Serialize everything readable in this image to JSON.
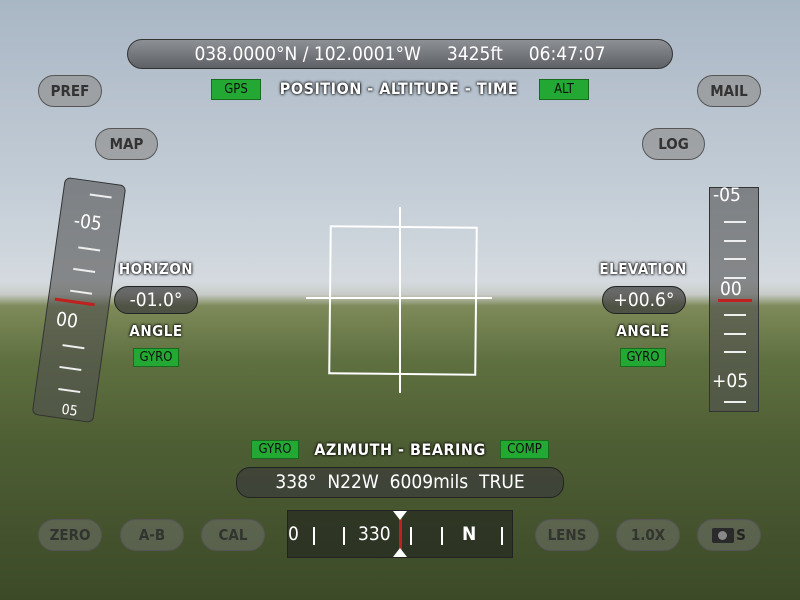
{
  "top": {
    "position": "038.0000°N / 102.0001°W",
    "altitude": "3425ft",
    "time": "06:47:07",
    "title": "POSITION - ALTITUDE - TIME",
    "gps_badge": "GPS",
    "alt_badge": "ALT"
  },
  "buttons": {
    "pref": "PREF",
    "mail": "MAIL",
    "map": "MAP",
    "log": "LOG",
    "zero": "ZERO",
    "ab": "A-B",
    "cal": "CAL",
    "lens": "LENS",
    "zoom": "1.0X",
    "shutter_suffix": "S"
  },
  "horizon": {
    "title": "HORIZON",
    "value": "-01.0°",
    "subtitle": "ANGLE",
    "badge": "GYRO",
    "tape_labels": [
      "-05",
      "00",
      "05"
    ]
  },
  "elevation": {
    "title": "ELEVATION",
    "value": "+00.6°",
    "subtitle": "ANGLE",
    "badge": "GYRO",
    "tape_labels": [
      "-05",
      "00",
      "+05"
    ]
  },
  "azimuth": {
    "left_badge": "GYRO",
    "title": "AZIMUTH - BEARING",
    "right_badge": "COMP",
    "readout": "338°  N22W  6009mils  TRUE",
    "compass_labels": [
      "0",
      "330",
      "N"
    ]
  },
  "colors": {
    "badge_green": "#22a833",
    "indicator_red": "#c0201e"
  }
}
